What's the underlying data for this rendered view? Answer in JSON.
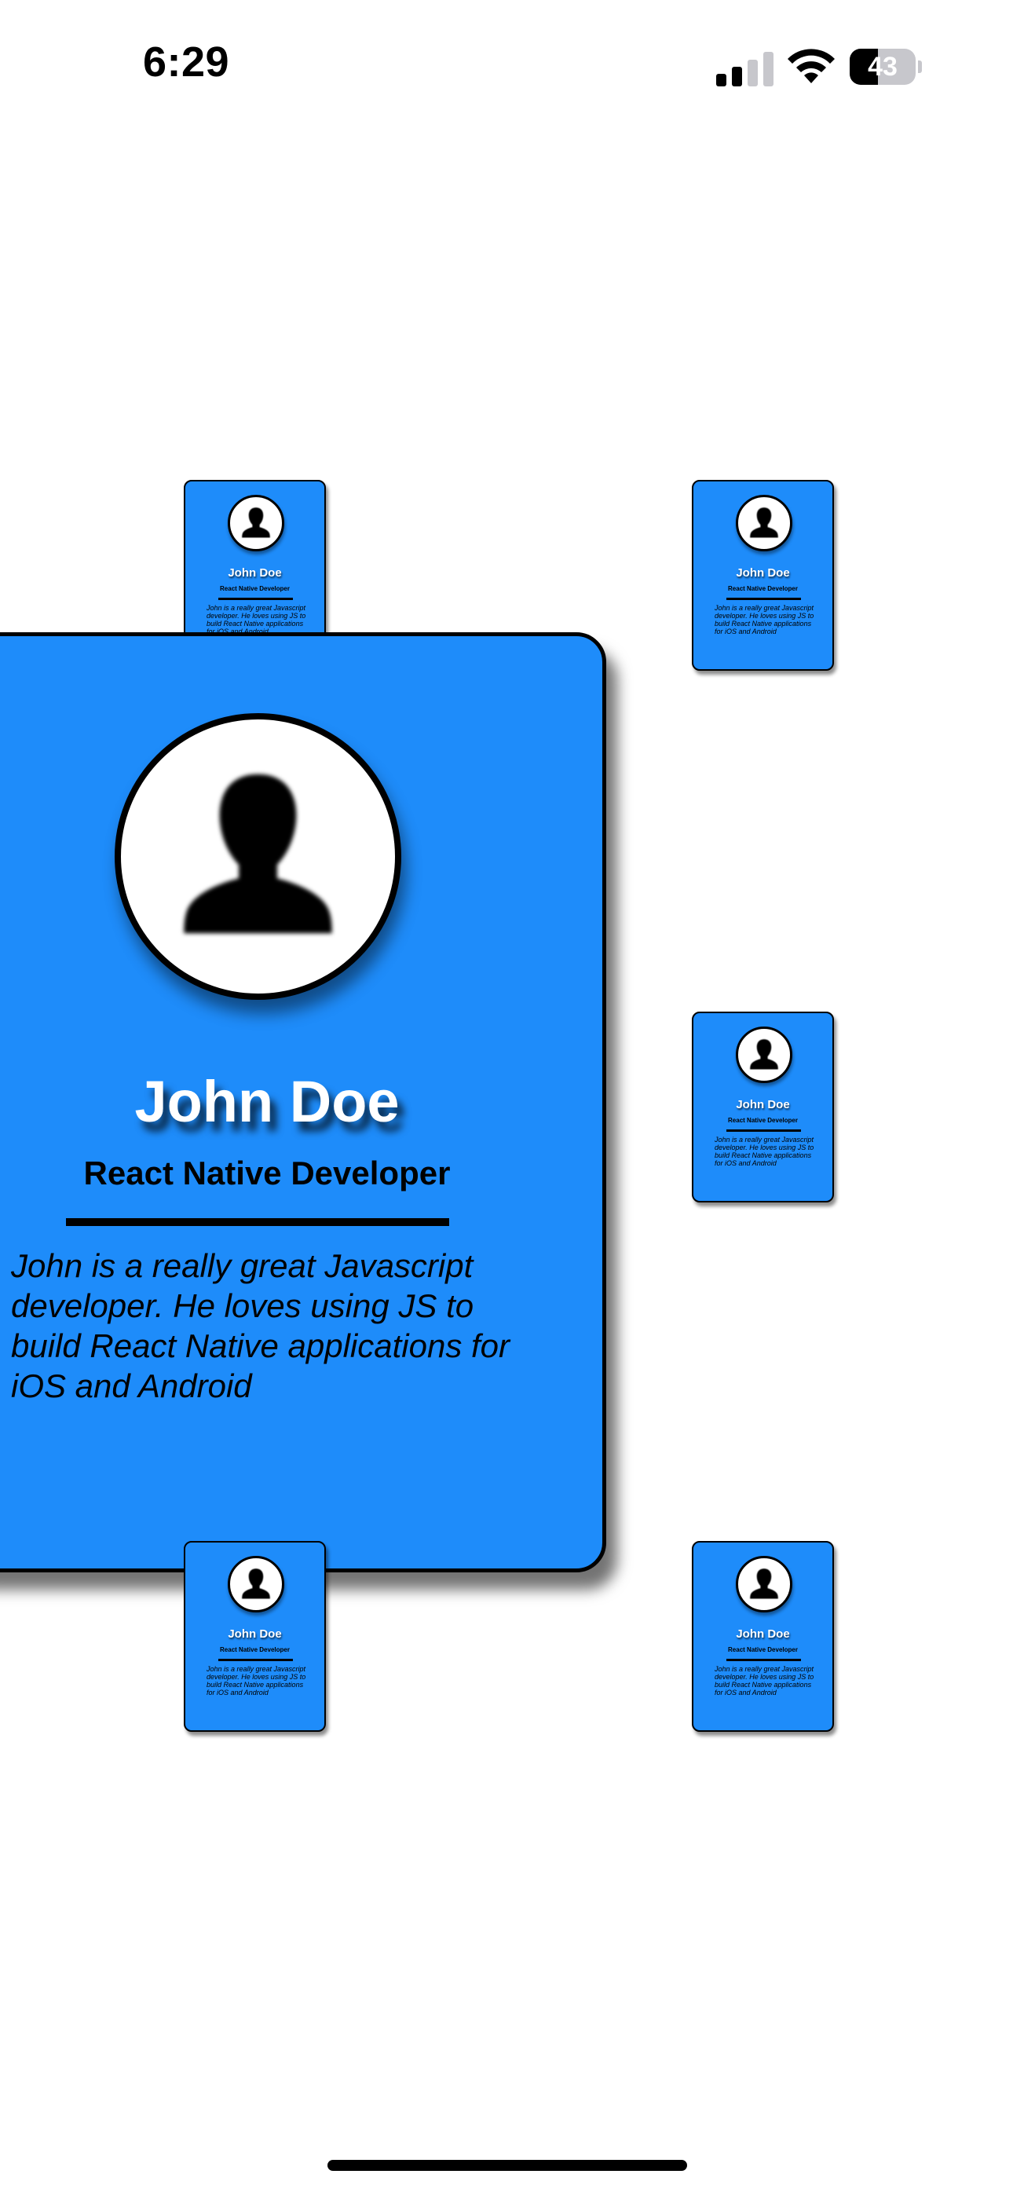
{
  "status_bar": {
    "time": "6:29",
    "battery_level": "43",
    "battery_percent": 43,
    "signal_bars_active": 2,
    "signal_bars_total": 4
  },
  "profile": {
    "name": "John Doe",
    "title": "React Native Developer",
    "bio": "John is a really great Javascript developer. He loves using JS to build React Native applications for iOS and Android",
    "avatar_icon": "person-silhouette-icon"
  },
  "colors": {
    "card_background": "#1e8cfa",
    "card_border": "#000000",
    "name_text": "#ffffff",
    "page_background": "#ffffff"
  }
}
